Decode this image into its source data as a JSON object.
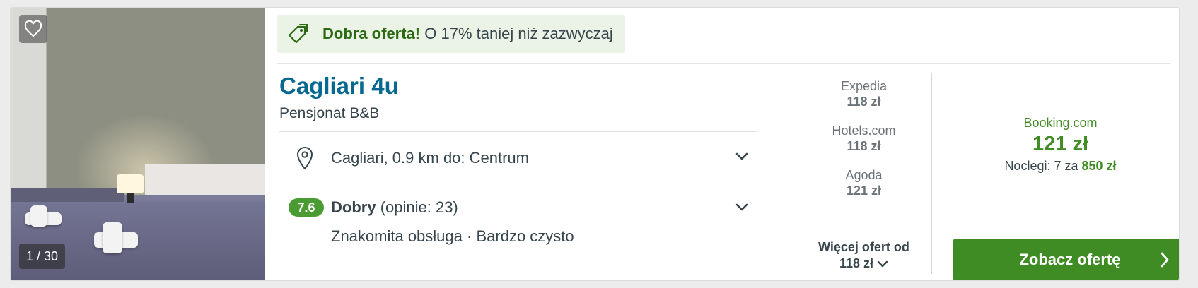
{
  "hotel": {
    "deal": {
      "label": "Dobra oferta!",
      "text": "O 17% taniej niż zazwyczaj"
    },
    "name": "Cagliari 4u",
    "type": "Pensjonat B&B",
    "location": "Cagliari, 0.9 km do: Centrum",
    "rating": {
      "score": "7.6",
      "label": "Dobry",
      "reviews": "(opinie: 23)",
      "highlight_1": "Znakomita obsługa",
      "separator": "·",
      "highlight_2": "Bardzo czysto"
    },
    "photo": {
      "counter": "1 / 30"
    }
  },
  "partners": [
    {
      "name": "Expedia",
      "price": "118 zł"
    },
    {
      "name": "Hotels.com",
      "price": "118 zł"
    },
    {
      "name": "Agoda",
      "price": "121 zł"
    }
  ],
  "more_offers": {
    "label": "Więcej ofert od",
    "price": "118 zł"
  },
  "top_offer": {
    "provider": "Booking.com",
    "price": "121 zł",
    "nights_label": "Noclegi: 7 za",
    "total": "850 zł",
    "cta": "Zobacz ofertę"
  },
  "icons": [
    "heart-icon",
    "price-tag-icon",
    "map-pin-icon",
    "chevron-down-icon",
    "chevron-right-icon"
  ],
  "colors": {
    "brand_blue": "#05688f",
    "deal_green": "#2b6a13",
    "score_green": "#4b9b33",
    "cta_green": "#3e8c23",
    "deal_bg": "#ebf3e6"
  }
}
